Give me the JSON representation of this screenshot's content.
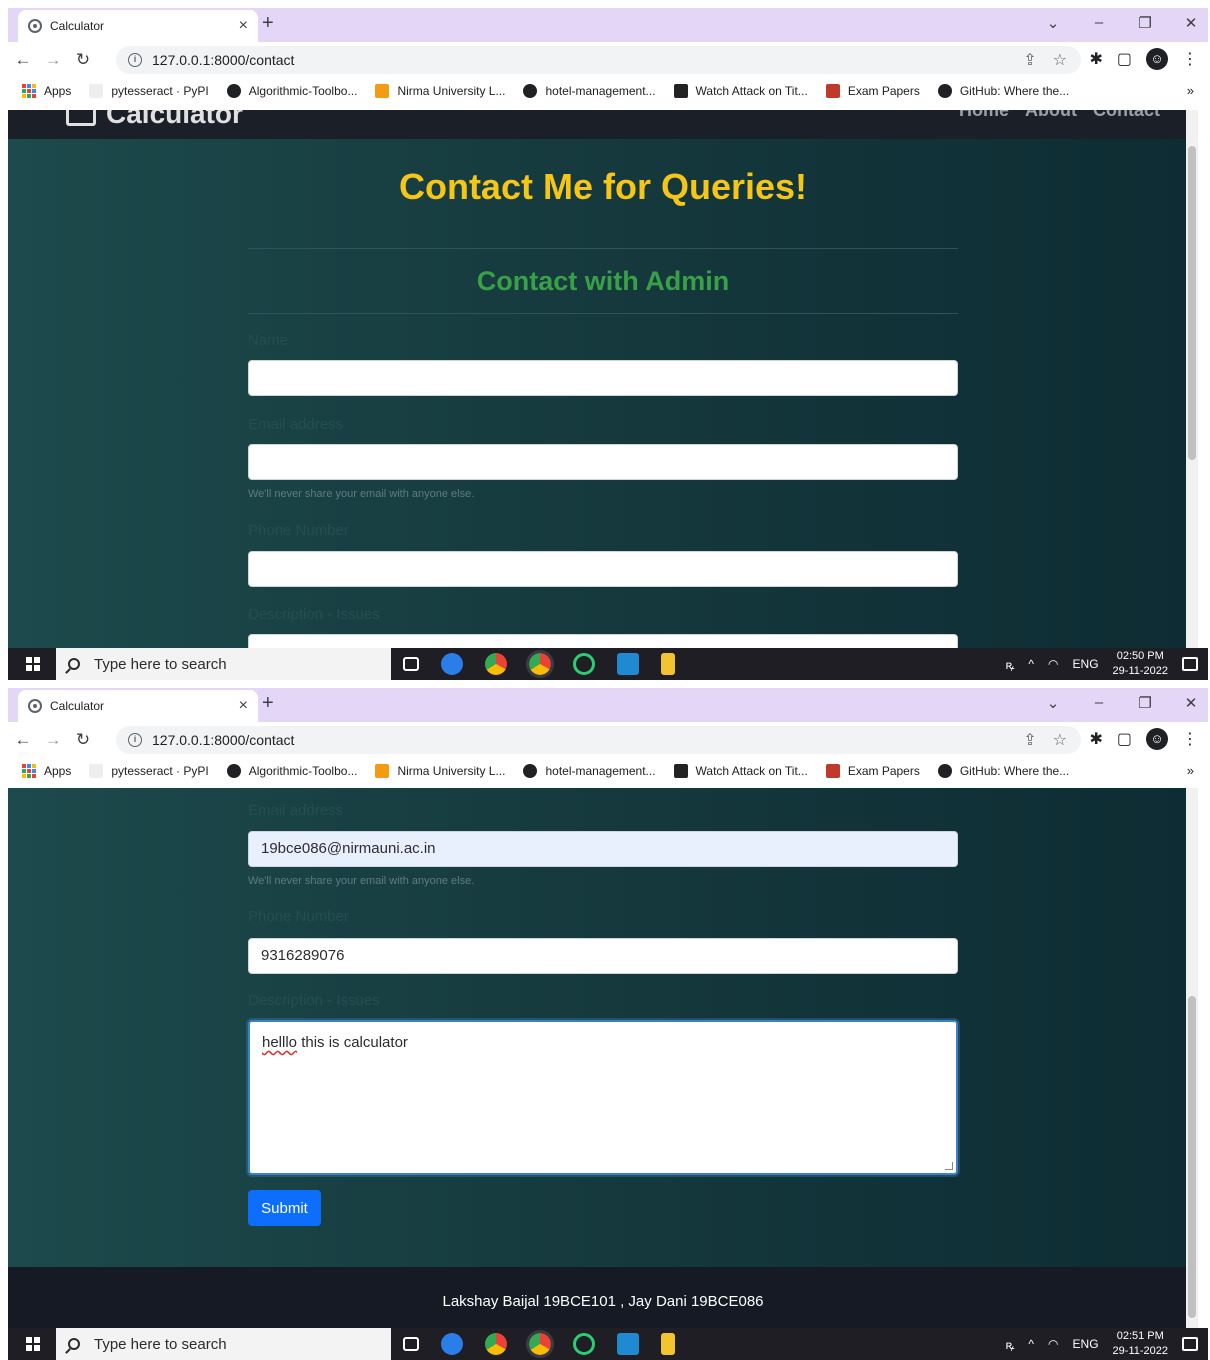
{
  "browser": {
    "tab_title": "Calculator",
    "tab_close": "×",
    "new_tab": "+",
    "url": "127.0.0.1:8000/contact",
    "window_controls": [
      "⌄",
      "–",
      "❐",
      "✕"
    ],
    "bookmarks": [
      "Apps",
      "pytesseract · PyPI",
      "Algorithmic-Toolbo...",
      "Nirma University L...",
      "hotel-management...",
      "Watch Attack on Tit...",
      "Exam Papers",
      "GitHub: Where the..."
    ],
    "bookmarks_more": "»",
    "icon_colors": {
      "accent": "#e4d6f7"
    }
  },
  "site": {
    "brand": "Calculator",
    "nav": [
      "Home",
      "About",
      "Contact"
    ],
    "heading": "Contact Me for Queries!",
    "subheading": "Contact with Admin",
    "colors": {
      "heading": "#f5c518",
      "subheading": "#3aa048",
      "button": "#0d6efd"
    }
  },
  "form": {
    "name_label": "Name",
    "email_label": "Email address",
    "email_help": "We'll never share your email with anyone else.",
    "phone_label": "Phone Number",
    "desc_label": "Description - Issues",
    "email_value": "19bce086@nirmauni.ac.in",
    "phone_value": "9316289076",
    "desc_misspelled": "helllo",
    "desc_rest": " this is calculator",
    "submit_label": "Submit"
  },
  "footer": {
    "text": "Lakshay Baijal 19BCE101 , Jay Dani 19BCE086"
  },
  "taskbar": {
    "search_placeholder": "Type here to search",
    "lang": "ENG",
    "time_top": "02:50 PM",
    "date_top": "29-11-2022",
    "time_bottom": "02:51 PM",
    "date_bottom": "29-11-2022"
  }
}
